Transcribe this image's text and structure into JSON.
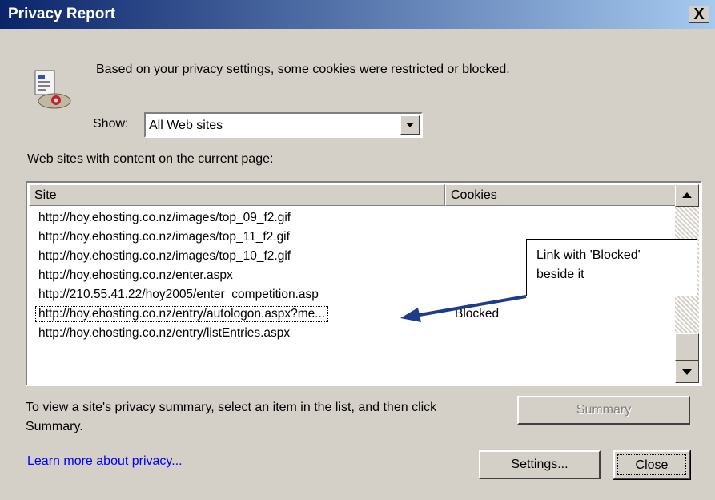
{
  "window": {
    "title": "Privacy Report",
    "close_glyph": "X"
  },
  "info": {
    "icon": "privacy-report-icon",
    "message": "Based on your privacy settings, some cookies were restricted or blocked."
  },
  "show": {
    "label": "Show:",
    "selected": "All Web sites"
  },
  "sites": {
    "label": "Web sites with content on the current page:",
    "columns": [
      "Site",
      "Cookies"
    ],
    "rows": [
      {
        "site": "http://hoy.ehosting.co.nz/images/top_09_f2.gif",
        "cookies": ""
      },
      {
        "site": "http://hoy.ehosting.co.nz/images/top_11_f2.gif",
        "cookies": ""
      },
      {
        "site": "http://hoy.ehosting.co.nz/images/top_10_f2.gif",
        "cookies": ""
      },
      {
        "site": "http://hoy.ehosting.co.nz/enter.aspx",
        "cookies": ""
      },
      {
        "site": "http://210.55.41.22/hoy2005/enter_competition.asp",
        "cookies": ""
      },
      {
        "site": "http://hoy.ehosting.co.nz/entry/autologon.aspx?me...",
        "cookies": "Blocked"
      },
      {
        "site": "http://hoy.ehosting.co.nz/entry/listEntries.aspx",
        "cookies": ""
      }
    ]
  },
  "annotation": {
    "line1": "Link with 'Blocked'",
    "line2": "beside it",
    "arrow_color": "#1e3c8c"
  },
  "footer": {
    "hint": "To view a site's privacy summary, select an item in the list, and then click Summary.",
    "summary": "Summary",
    "learn_more": "Learn more about privacy...",
    "settings": "Settings...",
    "close": "Close"
  }
}
